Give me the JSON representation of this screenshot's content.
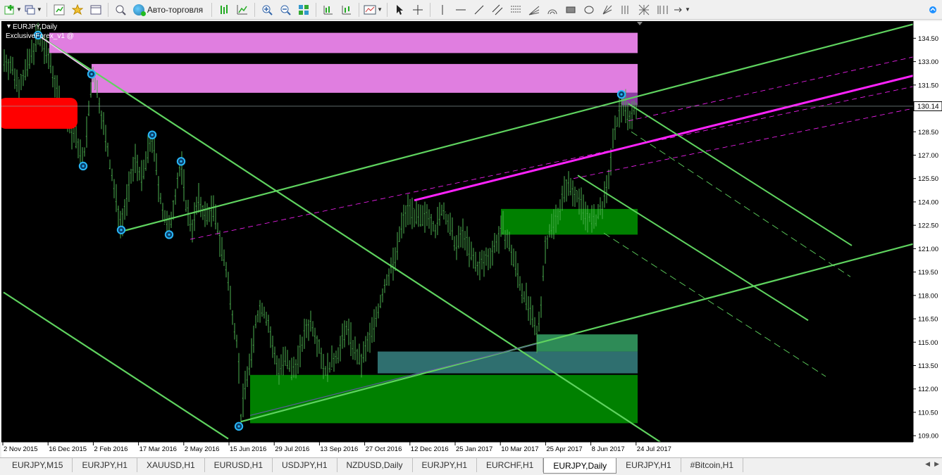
{
  "toolbar": {
    "auto_trading_label": "Авто-торговля"
  },
  "chart": {
    "symbol_title": "EURJPY,Daily",
    "indicator_name": "ExclusiveForex_v1 @",
    "current_price": "130.14",
    "price_min": 108.6,
    "price_max": 135.6,
    "price_ticks": [
      "134.50",
      "133.00",
      "131.50",
      "130.14",
      "128.50",
      "127.00",
      "125.50",
      "124.00",
      "122.50",
      "121.00",
      "119.50",
      "118.00",
      "116.50",
      "115.00",
      "113.50",
      "112.00",
      "110.50",
      "109.00"
    ],
    "date_ticks": [
      "2 Nov 2015",
      "16 Dec 2015",
      "2 Feb 2016",
      "17 Mar 2016",
      "2 May 2016",
      "15 Jun 2016",
      "29 Jul 2016",
      "13 Sep 2016",
      "27 Oct 2016",
      "12 Dec 2016",
      "25 Jan 2017",
      "10 Mar 2017",
      "25 Apr 2017",
      "8 Jun 2017",
      "24 Jul 2017"
    ],
    "colors": {
      "background": "#000000",
      "candles": "#4caf50",
      "channel": "#5fd35f",
      "trend_magenta": "#ff22ff",
      "zone_pink": "#e07ee0",
      "zone_green": "#008000",
      "zone_teal": "#2f6f6f",
      "marker": "#29b6f6",
      "alert_box": "#ff0000"
    }
  },
  "tabs": [
    {
      "label": "EURJPY,M15"
    },
    {
      "label": "EURJPY,H1"
    },
    {
      "label": "XAUUSD,H1"
    },
    {
      "label": "EURUSD,H1"
    },
    {
      "label": "USDJPY,H1"
    },
    {
      "label": "NZDUSD,Daily"
    },
    {
      "label": "EURJPY,H1"
    },
    {
      "label": "EURCHF,H1"
    },
    {
      "label": "EURJPY,Daily",
      "active": true
    },
    {
      "label": "EURJPY,H1"
    },
    {
      "label": "#Bitcoin,H1"
    }
  ]
}
